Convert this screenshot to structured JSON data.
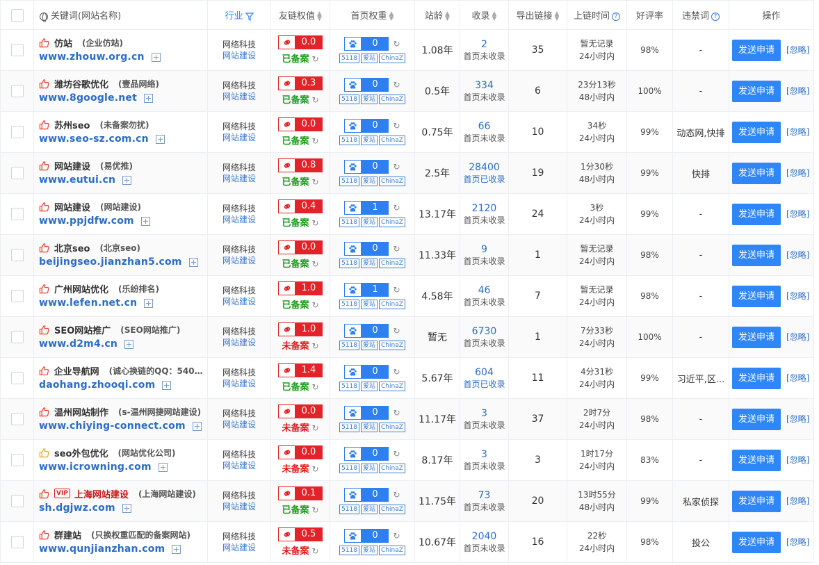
{
  "header": {
    "keyword": "关键词(网站名称)",
    "industry": "行业",
    "link_weight": "友链权值",
    "home_weight": "首页权重",
    "age": "站龄",
    "indexed": "收录",
    "out_links": "导出链接",
    "link_time": "上链时间",
    "rating": "好评率",
    "banned": "违禁词",
    "action": "操作"
  },
  "colors": {
    "accent": "#2f86f6",
    "danger": "#e4222a",
    "ok": "#1a9a1a"
  },
  "rows": [
    {
      "name": "仿站",
      "sub": "(企业仿站)",
      "url": "www.zhouw.org.cn",
      "vip": false,
      "ind1": "网络科技",
      "ind2": "网站建设",
      "lw": "0.0",
      "beian": "已备案",
      "beian_ok": true,
      "pw": "0",
      "age": "1.08年",
      "sl": "2",
      "slt": "首页未收录",
      "sl_ok": false,
      "out": "35",
      "t1": "暂无记录",
      "t2": "24小时内",
      "rate": "98%",
      "ban": "-",
      "thumb": "red"
    },
    {
      "name": "潍坊谷歌优化",
      "sub": "(壹品网络)",
      "url": "www.8google.net",
      "vip": false,
      "ind1": "网络科技",
      "ind2": "网站建设",
      "lw": "0.3",
      "beian": "已备案",
      "beian_ok": true,
      "pw": "0",
      "age": "0.5年",
      "sl": "334",
      "slt": "首页未收录",
      "sl_ok": false,
      "out": "6",
      "t1": "23分13秒",
      "t2": "48小时内",
      "rate": "100%",
      "ban": "-",
      "thumb": "red"
    },
    {
      "name": "苏州seo",
      "sub": "(未备案勿扰)",
      "url": "www.seo-sz.com.cn",
      "vip": false,
      "ind1": "网络科技",
      "ind2": "网站建设",
      "lw": "0.0",
      "beian": "已备案",
      "beian_ok": true,
      "pw": "0",
      "age": "0.75年",
      "sl": "66",
      "slt": "首页未收录",
      "sl_ok": false,
      "out": "10",
      "t1": "34秒",
      "t2": "24小时内",
      "rate": "99%",
      "ban": "动态网,快排",
      "thumb": "red"
    },
    {
      "name": "网站建设",
      "sub": "(易优推)",
      "url": "www.eutui.cn",
      "vip": false,
      "ind1": "网络科技",
      "ind2": "网站建设",
      "lw": "0.8",
      "beian": "已备案",
      "beian_ok": true,
      "pw": "0",
      "age": "2.5年",
      "sl": "28400",
      "slt": "首页已收录",
      "sl_ok": true,
      "out": "19",
      "t1": "1分30秒",
      "t2": "48小时内",
      "rate": "99%",
      "ban": "快排",
      "thumb": "red"
    },
    {
      "name": "网站建设",
      "sub": "(网站建设)",
      "url": "www.ppjdfw.com",
      "vip": false,
      "ind1": "网络科技",
      "ind2": "网站建设",
      "lw": "0.4",
      "beian": "已备案",
      "beian_ok": true,
      "pw": "1",
      "age": "13.17年",
      "sl": "2120",
      "slt": "首页未收录",
      "sl_ok": false,
      "out": "24",
      "t1": "3秒",
      "t2": "24小时内",
      "rate": "99%",
      "ban": "-",
      "thumb": "red"
    },
    {
      "name": "北京seo",
      "sub": "(北京seo)",
      "url": "beijingseo.jianzhan5.com",
      "vip": false,
      "ind1": "网络科技",
      "ind2": "网站建设",
      "lw": "0.0",
      "beian": "已备案",
      "beian_ok": true,
      "pw": "0",
      "age": "11.33年",
      "sl": "9",
      "slt": "首页未收录",
      "sl_ok": false,
      "out": "1",
      "t1": "暂无记录",
      "t2": "24小时内",
      "rate": "98%",
      "ban": "-",
      "thumb": "red"
    },
    {
      "name": "广州网站优化",
      "sub": "(乐纷排名)",
      "url": "www.lefen.net.cn",
      "vip": false,
      "ind1": "网络科技",
      "ind2": "网站建设",
      "lw": "1.0",
      "beian": "已备案",
      "beian_ok": true,
      "pw": "1",
      "age": "4.58年",
      "sl": "46",
      "slt": "首页未收录",
      "sl_ok": false,
      "out": "7",
      "t1": "暂无记录",
      "t2": "24小时内",
      "rate": "98%",
      "ban": "-",
      "thumb": "red"
    },
    {
      "name": "SEO网站推广",
      "sub": "(SEO网站推广)",
      "url": "www.d2m4.cn",
      "vip": false,
      "ind1": "网络科技",
      "ind2": "网站建设",
      "lw": "1.0",
      "beian": "未备案",
      "beian_ok": false,
      "pw": "0",
      "age": "暂无",
      "sl": "6730",
      "slt": "首页未收录",
      "sl_ok": false,
      "out": "1",
      "t1": "7分33秒",
      "t2": "24小时内",
      "rate": "100%",
      "ban": "-",
      "thumb": "red"
    },
    {
      "name": "企业导航网",
      "sub": "(诚心换链的QQ：5403...",
      "url": "daohang.zhooqi.com",
      "vip": false,
      "ind1": "网络科技",
      "ind2": "网站建设",
      "lw": "1.4",
      "beian": "已备案",
      "beian_ok": true,
      "pw": "0",
      "age": "5.67年",
      "sl": "604",
      "slt": "首页已收录",
      "sl_ok": true,
      "out": "11",
      "t1": "4分31秒",
      "t2": "24小时内",
      "rate": "99%",
      "ban": "习近平,区...",
      "thumb": "red"
    },
    {
      "name": "温州网站制作",
      "sub": "(s-温州网捷网站建设)",
      "url": "www.chiying-connect.com",
      "vip": false,
      "ind1": "网络科技",
      "ind2": "网站建设",
      "lw": "0.0",
      "beian": "未备案",
      "beian_ok": false,
      "pw": "0",
      "age": "11.17年",
      "sl": "3",
      "slt": "首页未收录",
      "sl_ok": false,
      "out": "37",
      "t1": "2时7分",
      "t2": "24小时内",
      "rate": "98%",
      "ban": "-",
      "thumb": "red"
    },
    {
      "name": "seo外包优化",
      "sub": "(网站优化公司)",
      "url": "www.icrowning.com",
      "vip": false,
      "ind1": "网络科技",
      "ind2": "网站建设",
      "lw": "0.0",
      "beian": "未备案",
      "beian_ok": false,
      "pw": "0",
      "age": "8.17年",
      "sl": "3",
      "slt": "首页未收录",
      "sl_ok": false,
      "out": "3",
      "t1": "1时17分",
      "t2": "24小时内",
      "rate": "83%",
      "ban": "-",
      "thumb": "orange"
    },
    {
      "name": "上海网站建设",
      "sub": "(上海网站建设)",
      "url": "sh.dgjwz.com",
      "vip": true,
      "vip_label": "VIP",
      "ind1": "网络科技",
      "ind2": "网站建设",
      "lw": "0.1",
      "beian": "已备案",
      "beian_ok": true,
      "pw": "0",
      "age": "11.75年",
      "sl": "73",
      "slt": "首页未收录",
      "sl_ok": false,
      "out": "20",
      "t1": "13时55分",
      "t2": "48小时内",
      "rate": "99%",
      "ban": "私家侦探",
      "thumb": "red"
    },
    {
      "name": "群建站",
      "sub": "(只换权重匹配的备案网站)",
      "url": "www.qunjianzhan.com",
      "vip": false,
      "ind1": "网络科技",
      "ind2": "网站建设",
      "lw": "0.5",
      "beian": "未备案",
      "beian_ok": false,
      "pw": "0",
      "age": "10.67年",
      "sl": "2040",
      "slt": "首页未收录",
      "sl_ok": false,
      "out": "16",
      "t1": "22秒",
      "t2": "24小时内",
      "rate": "98%",
      "ban": "投公",
      "thumb": "red"
    }
  ],
  "labels": {
    "send": "发送申请",
    "ignore": "[忽略]",
    "tag_5118": "5118",
    "tag_aizhan": "爱站",
    "tag_chinaz": "ChinaZ"
  }
}
